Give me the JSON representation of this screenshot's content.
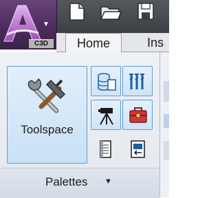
{
  "app": {
    "badge": "C3D",
    "menu_caret": "▼",
    "accent": "#4f2b60"
  },
  "quick_access": {
    "icons": [
      "new-file-icon",
      "open-folder-icon",
      "save-icon"
    ]
  },
  "ribbon": {
    "tabs": [
      {
        "label": "Home",
        "active": true
      },
      {
        "label": "Ins",
        "active": false
      }
    ]
  },
  "palettes_panel": {
    "toolspace_label": "Toolspace",
    "panel_title": "Palettes",
    "panel_caret": "▼",
    "buttons": [
      {
        "icon": "database-icon",
        "active": true
      },
      {
        "icon": "tool-palette-icon",
        "active": true
      },
      {
        "icon": "survey-tripod-icon",
        "active": true
      },
      {
        "icon": "toolbox-icon",
        "active": true
      },
      {
        "icon": "properties-icon",
        "active": false
      },
      {
        "icon": "panel-import-icon",
        "active": false
      }
    ]
  },
  "colors": {
    "active_border": "#5f9bd3",
    "active_fill": "#cfe3f7",
    "ribbon_bg": "#eef1f5"
  }
}
